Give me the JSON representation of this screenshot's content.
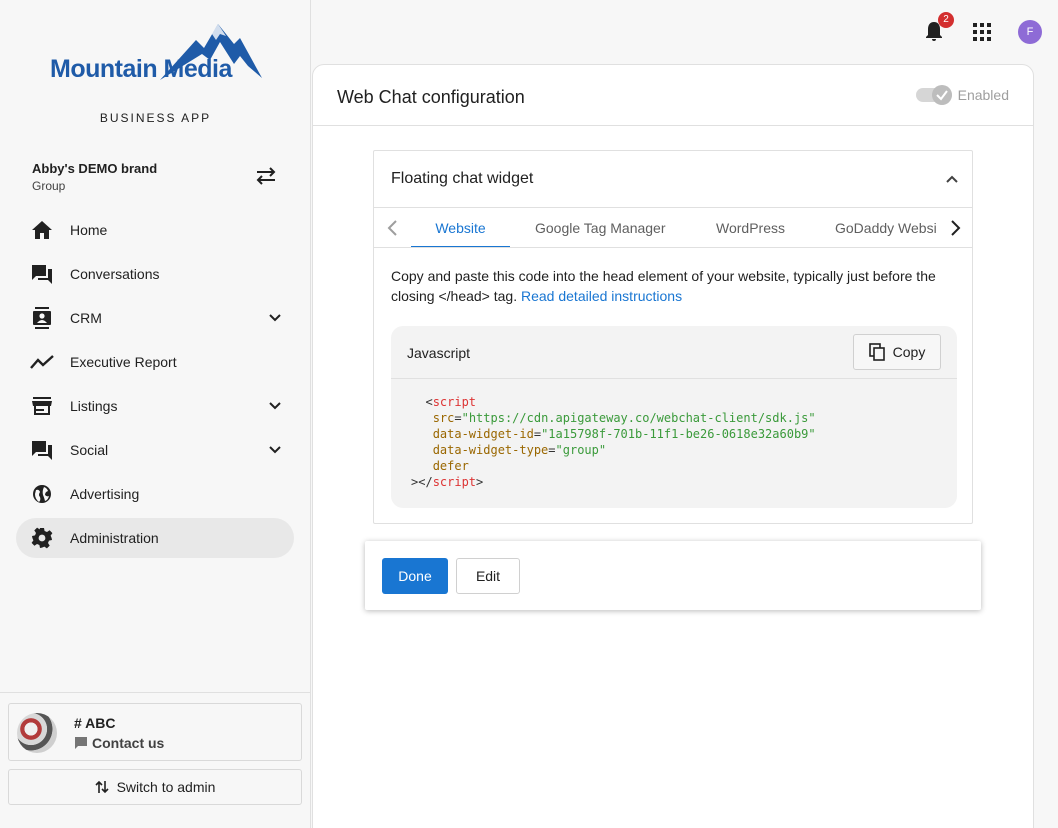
{
  "sidebar": {
    "logo_text": "Mountain Media",
    "app_label": "BUSINESS APP",
    "brand": {
      "name": "Abby's DEMO brand",
      "type": "Group"
    },
    "items": [
      {
        "label": "Home",
        "icon": "home-icon",
        "expandable": false
      },
      {
        "label": "Conversations",
        "icon": "conversations-icon",
        "expandable": false
      },
      {
        "label": "CRM",
        "icon": "crm-icon",
        "expandable": true
      },
      {
        "label": "Executive Report",
        "icon": "trending-icon",
        "expandable": false
      },
      {
        "label": "Listings",
        "icon": "storefront-icon",
        "expandable": true
      },
      {
        "label": "Social",
        "icon": "social-icon",
        "expandable": true
      },
      {
        "label": "Advertising",
        "icon": "globe-icon",
        "expandable": false
      },
      {
        "label": "Administration",
        "icon": "gear-icon",
        "expandable": false,
        "active": true
      }
    ],
    "account": {
      "title": "# ABC",
      "contact_label": "Contact us"
    },
    "switch_admin_label": "Switch to admin"
  },
  "topbar": {
    "notification_count": "2",
    "user_initial": "F"
  },
  "main": {
    "title": "Web Chat configuration",
    "toggle_label": "Enabled",
    "toggle_on": true,
    "widget": {
      "title": "Floating chat widget",
      "tabs": [
        "Website",
        "Google Tag Manager",
        "WordPress",
        "GoDaddy Websi"
      ],
      "active_tab": "Website",
      "instructions": "Copy and paste this code into the head element of your website, typically just before the closing </head> tag.",
      "instructions_link": "Read detailed instructions",
      "code_language": "Javascript",
      "copy_label": "Copy",
      "code": {
        "open_tag": "script",
        "src_attr": "src",
        "src_value": "\"https://cdn.apigateway.co/webchat-client/sdk.js\"",
        "id_attr": "data-widget-id",
        "id_value": "\"1a15798f-701b-11f1-be26-0618e32a60b9\"",
        "type_attr": "data-widget-type",
        "type_value": "\"group\"",
        "defer_attr": "defer",
        "close_tag": "script"
      }
    },
    "actions": {
      "done_label": "Done",
      "edit_label": "Edit"
    }
  },
  "colors": {
    "accent": "#1976d2",
    "badge": "#d32f2f",
    "avatar": "#8e6bd6",
    "logo": "#1f5ba8"
  }
}
